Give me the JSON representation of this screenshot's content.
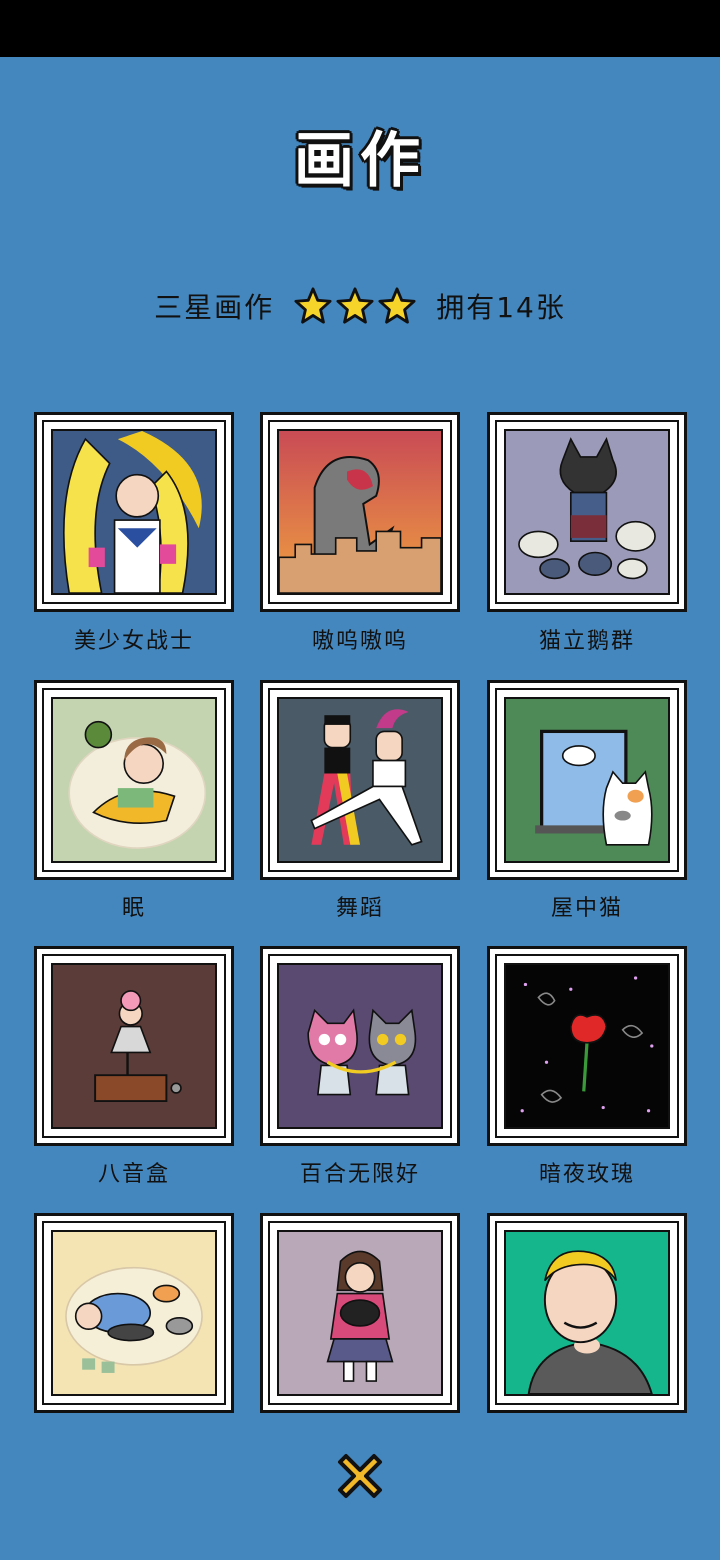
{
  "header": {
    "title": "画作"
  },
  "summary": {
    "tier_label": "三星画作",
    "stars": 3,
    "owned_label": "拥有14张"
  },
  "paintings": [
    {
      "label": "美少女战士",
      "bg": "#3E5A86"
    },
    {
      "label": "嗷呜嗷呜",
      "bg": "#D9573D"
    },
    {
      "label": "猫立鹅群",
      "bg": "#9B9AB8"
    },
    {
      "label": "眠",
      "bg": "#C4D4B0"
    },
    {
      "label": "舞蹈",
      "bg": "#4A5A66"
    },
    {
      "label": "屋中猫",
      "bg": "#4D8A57"
    },
    {
      "label": "八音盒",
      "bg": "#5C3C38"
    },
    {
      "label": "百合无限好",
      "bg": "#5A4A72"
    },
    {
      "label": "暗夜玫瑰",
      "bg": "#050505"
    },
    {
      "label": "",
      "bg": "#F4E4B4"
    },
    {
      "label": "",
      "bg": "#B8A8B8"
    },
    {
      "label": "",
      "bg": "#15B68C"
    }
  ],
  "icons": {
    "close": "close-x-icon",
    "star": "star-icon"
  }
}
